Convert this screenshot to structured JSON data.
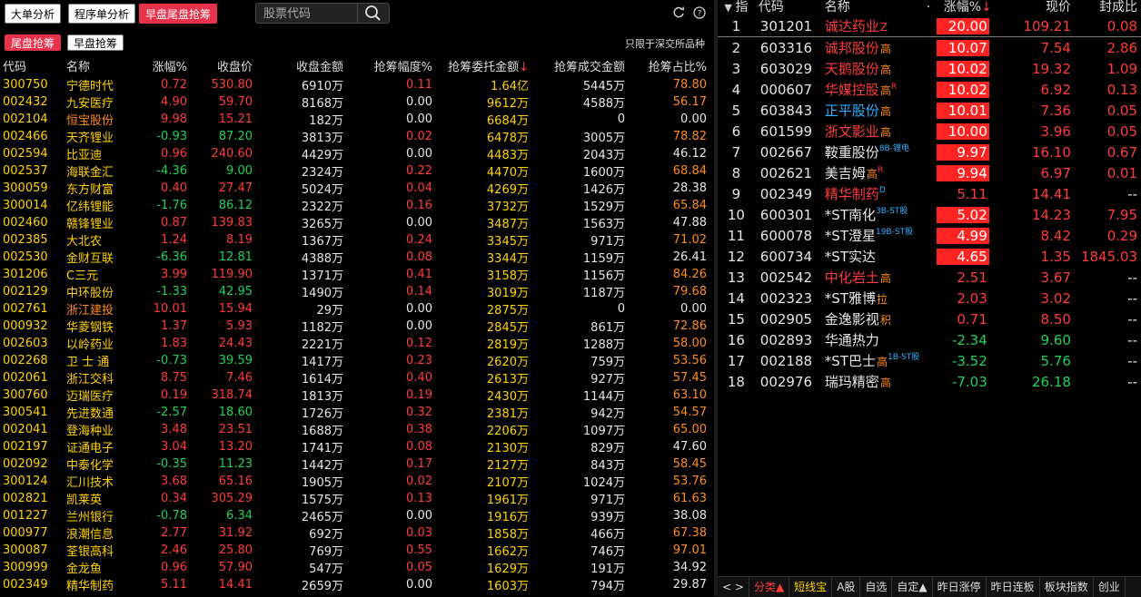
{
  "colors": {
    "up": "#ff3b3b",
    "down": "#1fd15a",
    "name": "#ffd200",
    "flat": "#e6e6e6",
    "accent": "#e8324b"
  },
  "toolbar": {
    "tabs": [
      "大单分析",
      "程序单分析",
      "早盘尾盘抢筹"
    ],
    "active_tab": 2,
    "search_placeholder": "股票代码",
    "icons": [
      "search-icon",
      "refresh-icon",
      "help-icon"
    ]
  },
  "subtabs": {
    "items": [
      "尾盘抢筹",
      "早盘抢筹"
    ],
    "active": 0
  },
  "note": "只限于深交所品种",
  "left_table": {
    "headers": [
      "代码",
      "名称",
      "涨幅%",
      "收盘价",
      "收盘金额",
      "抢筹幅度%",
      "抢筹委托金额",
      "抢筹成交金额",
      "抢筹占比%"
    ],
    "sort_arrow": "↓",
    "rows": [
      {
        "code": "300750",
        "name": "宁德时代",
        "pct": "0.72",
        "close": "530.80",
        "amt": "6910万",
        "range": "0.11",
        "order": "1.64亿",
        "deal": "5445万",
        "ratio": "78.80",
        "dir": "up",
        "nameColor": "yellow"
      },
      {
        "code": "002432",
        "name": "九安医疗",
        "pct": "4.90",
        "close": "59.70",
        "amt": "8168万",
        "range": "0.00",
        "order": "9612万",
        "deal": "4588万",
        "ratio": "56.17",
        "dir": "up",
        "nameColor": "yellow"
      },
      {
        "code": "002104",
        "name": "恒宝股份",
        "pct": "9.98",
        "close": "15.21",
        "amt": "182万",
        "range": "0.00",
        "order": "6684万",
        "deal": "0",
        "ratio": "0.00",
        "dir": "up",
        "nameColor": "orange"
      },
      {
        "code": "002466",
        "name": "天齐锂业",
        "pct": "-0.93",
        "close": "87.20",
        "amt": "3813万",
        "range": "0.02",
        "order": "6478万",
        "deal": "3005万",
        "ratio": "78.82",
        "dir": "down",
        "nameColor": "yellow"
      },
      {
        "code": "002594",
        "name": "比亚迪",
        "pct": "0.96",
        "close": "240.60",
        "amt": "4429万",
        "range": "0.00",
        "order": "4483万",
        "deal": "2043万",
        "ratio": "46.12",
        "dir": "up",
        "nameColor": "yellow"
      },
      {
        "code": "002537",
        "name": "海联金汇",
        "pct": "-4.36",
        "close": "9.00",
        "amt": "2324万",
        "range": "0.22",
        "order": "4470万",
        "deal": "1600万",
        "ratio": "68.84",
        "dir": "down",
        "nameColor": "yellow"
      },
      {
        "code": "300059",
        "name": "东方财富",
        "pct": "0.40",
        "close": "27.47",
        "amt": "5024万",
        "range": "0.04",
        "order": "4269万",
        "deal": "1426万",
        "ratio": "28.38",
        "dir": "up",
        "nameColor": "yellow"
      },
      {
        "code": "300014",
        "name": "亿纬锂能",
        "pct": "-1.76",
        "close": "86.12",
        "amt": "2322万",
        "range": "0.16",
        "order": "3732万",
        "deal": "1529万",
        "ratio": "65.84",
        "dir": "down",
        "nameColor": "yellow"
      },
      {
        "code": "002460",
        "name": "赣锋锂业",
        "pct": "0.87",
        "close": "139.83",
        "amt": "3265万",
        "range": "0.00",
        "order": "3487万",
        "deal": "1563万",
        "ratio": "47.88",
        "dir": "up",
        "nameColor": "yellow"
      },
      {
        "code": "002385",
        "name": "大北农",
        "pct": "1.24",
        "close": "8.19",
        "amt": "1367万",
        "range": "0.24",
        "order": "3345万",
        "deal": "971万",
        "ratio": "71.02",
        "dir": "up",
        "nameColor": "yellow"
      },
      {
        "code": "002530",
        "name": "金财互联",
        "pct": "-6.36",
        "close": "12.81",
        "amt": "4388万",
        "range": "0.08",
        "order": "3344万",
        "deal": "1159万",
        "ratio": "26.41",
        "dir": "down",
        "nameColor": "yellow"
      },
      {
        "code": "301206",
        "name": "C三元",
        "pct": "3.99",
        "close": "119.90",
        "amt": "1371万",
        "range": "0.41",
        "order": "3158万",
        "deal": "1156万",
        "ratio": "84.26",
        "dir": "up",
        "nameColor": "yellow"
      },
      {
        "code": "002129",
        "name": "中环股份",
        "pct": "-1.33",
        "close": "42.95",
        "amt": "1490万",
        "range": "0.14",
        "order": "3019万",
        "deal": "1187万",
        "ratio": "79.68",
        "dir": "down",
        "nameColor": "yellow"
      },
      {
        "code": "002761",
        "name": "浙江建投",
        "pct": "10.01",
        "close": "15.94",
        "amt": "29万",
        "range": "0.00",
        "order": "2875万",
        "deal": "0",
        "ratio": "0.00",
        "dir": "up",
        "nameColor": "orange"
      },
      {
        "code": "000932",
        "name": "华菱钢铁",
        "pct": "1.37",
        "close": "5.93",
        "amt": "1182万",
        "range": "0.00",
        "order": "2845万",
        "deal": "861万",
        "ratio": "72.86",
        "dir": "up",
        "nameColor": "yellow"
      },
      {
        "code": "002603",
        "name": "以岭药业",
        "pct": "1.83",
        "close": "24.43",
        "amt": "2221万",
        "range": "0.12",
        "order": "2819万",
        "deal": "1288万",
        "ratio": "58.00",
        "dir": "up",
        "nameColor": "yellow"
      },
      {
        "code": "002268",
        "name": "卫 士 通",
        "pct": "-0.73",
        "close": "39.59",
        "amt": "1417万",
        "range": "0.23",
        "order": "2620万",
        "deal": "759万",
        "ratio": "53.56",
        "dir": "down",
        "nameColor": "yellow"
      },
      {
        "code": "002061",
        "name": "浙江交科",
        "pct": "8.75",
        "close": "7.46",
        "amt": "1614万",
        "range": "0.40",
        "order": "2613万",
        "deal": "927万",
        "ratio": "57.45",
        "dir": "up",
        "nameColor": "yellow"
      },
      {
        "code": "300760",
        "name": "迈瑞医疗",
        "pct": "0.19",
        "close": "318.74",
        "amt": "1813万",
        "range": "0.19",
        "order": "2430万",
        "deal": "1144万",
        "ratio": "63.10",
        "dir": "up",
        "nameColor": "yellow"
      },
      {
        "code": "300541",
        "name": "先进数通",
        "pct": "-2.57",
        "close": "18.60",
        "amt": "1726万",
        "range": "0.32",
        "order": "2381万",
        "deal": "942万",
        "ratio": "54.57",
        "dir": "down",
        "nameColor": "yellow"
      },
      {
        "code": "002041",
        "name": "登海种业",
        "pct": "3.48",
        "close": "23.51",
        "amt": "1688万",
        "range": "0.38",
        "order": "2206万",
        "deal": "1097万",
        "ratio": "65.00",
        "dir": "up",
        "nameColor": "yellow"
      },
      {
        "code": "002197",
        "name": "证通电子",
        "pct": "3.04",
        "close": "13.20",
        "amt": "1741万",
        "range": "0.08",
        "order": "2130万",
        "deal": "829万",
        "ratio": "47.60",
        "dir": "up",
        "nameColor": "yellow"
      },
      {
        "code": "002092",
        "name": "中泰化学",
        "pct": "-0.35",
        "close": "11.23",
        "amt": "1442万",
        "range": "0.17",
        "order": "2127万",
        "deal": "843万",
        "ratio": "58.45",
        "dir": "down",
        "nameColor": "yellow"
      },
      {
        "code": "300124",
        "name": "汇川技术",
        "pct": "3.68",
        "close": "65.16",
        "amt": "1905万",
        "range": "0.02",
        "order": "2107万",
        "deal": "1024万",
        "ratio": "53.76",
        "dir": "up",
        "nameColor": "yellow"
      },
      {
        "code": "002821",
        "name": "凯莱英",
        "pct": "0.34",
        "close": "305.29",
        "amt": "1575万",
        "range": "0.13",
        "order": "1961万",
        "deal": "971万",
        "ratio": "61.63",
        "dir": "up",
        "nameColor": "yellow"
      },
      {
        "code": "001227",
        "name": "兰州银行",
        "pct": "-0.78",
        "close": "6.34",
        "amt": "2465万",
        "range": "0.00",
        "order": "1916万",
        "deal": "939万",
        "ratio": "38.08",
        "dir": "down",
        "nameColor": "yellow"
      },
      {
        "code": "000977",
        "name": "浪潮信息",
        "pct": "2.77",
        "close": "31.92",
        "amt": "692万",
        "range": "0.03",
        "order": "1858万",
        "deal": "466万",
        "ratio": "67.38",
        "dir": "up",
        "nameColor": "yellow"
      },
      {
        "code": "300087",
        "name": "荃银高科",
        "pct": "2.46",
        "close": "25.80",
        "amt": "769万",
        "range": "0.55",
        "order": "1662万",
        "deal": "746万",
        "ratio": "97.01",
        "dir": "up",
        "nameColor": "yellow"
      },
      {
        "code": "300999",
        "name": "金龙鱼",
        "pct": "0.96",
        "close": "57.90",
        "amt": "547万",
        "range": "0.05",
        "order": "1629万",
        "deal": "191万",
        "ratio": "34.92",
        "dir": "up",
        "nameColor": "yellow"
      },
      {
        "code": "002349",
        "name": "精华制药",
        "pct": "5.11",
        "close": "14.41",
        "amt": "2659万",
        "range": "0.00",
        "order": "1603万",
        "deal": "794万",
        "ratio": "29.87",
        "dir": "up",
        "nameColor": "yellow"
      }
    ]
  },
  "right_table": {
    "headers": [
      "指",
      "代码",
      "名称",
      "·",
      "涨幅%",
      "现价",
      "封成比"
    ],
    "sort_arrow": "↓",
    "rows": [
      {
        "idx": "1",
        "code": "301201",
        "name": "诚达药业",
        "tag": "Z",
        "tagColor": "r",
        "pct": "20.00",
        "price": "109.21",
        "ratio": "0.08",
        "hl": true,
        "nameColor": "red",
        "dir": "up",
        "underline": true
      },
      {
        "idx": "2",
        "code": "603316",
        "name": "诚邦股份",
        "tag": "高",
        "tagColor": "o",
        "pct": "10.07",
        "price": "7.54",
        "ratio": "2.86",
        "hl": true,
        "nameColor": "red",
        "dir": "up"
      },
      {
        "idx": "3",
        "code": "603029",
        "name": "天鹅股份",
        "tag": "高",
        "tagColor": "o",
        "pct": "10.02",
        "price": "19.32",
        "ratio": "1.09",
        "hl": true,
        "nameColor": "red",
        "dir": "up"
      },
      {
        "idx": "4",
        "code": "000607",
        "name": "华媒控股",
        "tag": "高",
        "tagColor": "o",
        "sup": "R",
        "pct": "10.02",
        "price": "6.92",
        "ratio": "0.13",
        "hl": true,
        "nameColor": "red",
        "dir": "up"
      },
      {
        "idx": "5",
        "code": "603843",
        "name": "正平股份",
        "tag": "高",
        "tagColor": "o",
        "pct": "10.01",
        "price": "7.36",
        "ratio": "0.05",
        "hl": true,
        "nameColor": "blue",
        "dir": "up"
      },
      {
        "idx": "6",
        "code": "601599",
        "name": "浙文影业",
        "tag": "高",
        "tagColor": "o",
        "pct": "10.00",
        "price": "3.96",
        "ratio": "0.05",
        "hl": true,
        "nameColor": "red",
        "dir": "up"
      },
      {
        "idx": "7",
        "code": "002667",
        "name": "鞍重股份",
        "tag": "",
        "tagColor": "o",
        "supb": "8B-锂电",
        "pct": "9.97",
        "price": "16.10",
        "ratio": "0.67",
        "hl": true,
        "nameColor": "white",
        "dir": "up"
      },
      {
        "idx": "8",
        "code": "002621",
        "name": "美吉姆",
        "tag": "高",
        "tagColor": "o",
        "sup": "R",
        "pct": "9.94",
        "price": "6.97",
        "ratio": "0.01",
        "hl": true,
        "nameColor": "white",
        "dir": "up"
      },
      {
        "idx": "9",
        "code": "002349",
        "name": "精华制药",
        "tag": "",
        "tagColor": "o",
        "supb": "D",
        "pct": "5.11",
        "price": "14.41",
        "ratio": "--",
        "hl": false,
        "nameColor": "red",
        "dir": "up"
      },
      {
        "idx": "10",
        "code": "600301",
        "name": "*ST南化",
        "tag": "",
        "tagColor": "o",
        "supb": "3B-ST股",
        "pct": "5.02",
        "price": "14.23",
        "ratio": "7.95",
        "hl": true,
        "nameColor": "white",
        "dir": "up"
      },
      {
        "idx": "11",
        "code": "600078",
        "name": "*ST澄星",
        "tag": "",
        "tagColor": "o",
        "supb": "19B-ST股",
        "pct": "4.99",
        "price": "8.42",
        "ratio": "0.29",
        "hl": true,
        "nameColor": "white",
        "dir": "up"
      },
      {
        "idx": "12",
        "code": "600734",
        "name": "*ST实达",
        "tag": "",
        "tagColor": "o",
        "pct": "4.65",
        "price": "1.35",
        "ratio": "1845.03",
        "hl": true,
        "nameColor": "white",
        "dir": "up"
      },
      {
        "idx": "13",
        "code": "002542",
        "name": "中化岩土",
        "tag": "高",
        "tagColor": "o",
        "pct": "2.51",
        "price": "3.67",
        "ratio": "--",
        "hl": false,
        "nameColor": "red",
        "dir": "up"
      },
      {
        "idx": "14",
        "code": "002323",
        "name": "*ST雅博",
        "tag": "拉",
        "tagColor": "o",
        "pct": "2.03",
        "price": "3.02",
        "ratio": "--",
        "hl": false,
        "nameColor": "white",
        "dir": "up"
      },
      {
        "idx": "15",
        "code": "002905",
        "name": "金逸影视",
        "tag": "积",
        "tagColor": "o",
        "pct": "0.71",
        "price": "8.50",
        "ratio": "--",
        "hl": false,
        "nameColor": "white",
        "dir": "up"
      },
      {
        "idx": "16",
        "code": "002893",
        "name": "华通热力",
        "tag": "",
        "tagColor": "o",
        "pct": "-2.34",
        "price": "9.60",
        "ratio": "--",
        "hl": false,
        "nameColor": "white",
        "dir": "down"
      },
      {
        "idx": "17",
        "code": "002188",
        "name": "*ST巴士",
        "tag": "高",
        "tagColor": "o",
        "supb": "1B-ST股",
        "pct": "-3.52",
        "price": "5.76",
        "ratio": "--",
        "hl": false,
        "nameColor": "white",
        "dir": "down"
      },
      {
        "idx": "18",
        "code": "002976",
        "name": "瑞玛精密",
        "tag": "高",
        "tagColor": "o",
        "pct": "-7.03",
        "price": "26.18",
        "ratio": "--",
        "hl": false,
        "nameColor": "white",
        "dir": "down"
      }
    ]
  },
  "bottom_tabs": [
    "< >",
    "分类▲",
    "短线宝",
    "A股",
    "自选",
    "自定▲",
    "昨日涨停",
    "昨日连板",
    "板块指数",
    "创业"
  ]
}
